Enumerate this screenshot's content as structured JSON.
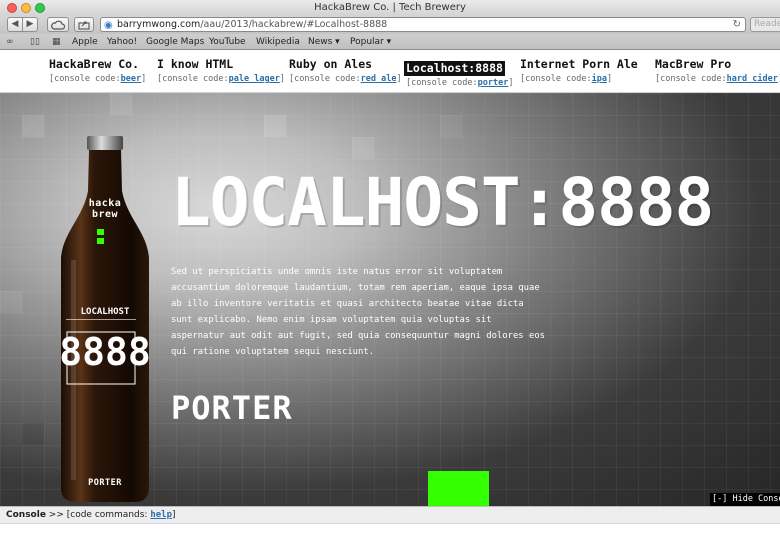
{
  "window": {
    "title": "HackaBrew Co. | Tech Brewery"
  },
  "toolbar": {
    "back_glyph": "◀",
    "forward_glyph": "▶",
    "url_domain": "barrymwong.com",
    "url_path": "/aau/2013/hackabrew/#Localhost-8888",
    "reader_label": "Reader",
    "reload_glyph": "↻"
  },
  "bookmarks": {
    "items": [
      "Apple",
      "Yahoo!",
      "Google Maps",
      "YouTube",
      "Wikipedia",
      "News ▾",
      "Popular ▾"
    ]
  },
  "nav": {
    "code_prefix": "[console code:",
    "code_suffix": "]",
    "items": [
      {
        "name": "HackaBrew Co.",
        "code": "beer"
      },
      {
        "name": "I know HTML",
        "code": "pale lager"
      },
      {
        "name": "Ruby on Ales",
        "code": "red ale"
      },
      {
        "name": "Localhost:8888",
        "code": "porter"
      },
      {
        "name": "Internet Porn Ale",
        "code": "ipa"
      },
      {
        "name": "MacBrew Pro",
        "code": "hard cider"
      }
    ],
    "active_index": 3
  },
  "hero": {
    "title": "LOCALHOST:8888",
    "body": "Sed ut perspiciatis unde omnis iste natus error sit voluptatem accusantium doloremque laudantium, totam rem aperiam, eaque ipsa quae ab illo inventore veritatis et quasi architecto beatae vitae dicta sunt explicabo. Nemo enim ipsam voluptatem quia voluptas sit aspernatur aut odit aut fugit, sed quia consequuntur magni dolores eos qui ratione voluptatem sequi nesciunt.",
    "style": "PORTER",
    "bottle": {
      "brand_line1": "hacka",
      "brand_line2": "brew",
      "label_line1": "LOCALHOST",
      "label_line2": "8888",
      "bottom": "PORTER"
    },
    "hide_console": "[-] Hide Console"
  },
  "console": {
    "title": "Console",
    "prompt": " >> [code commands: ",
    "help": "help",
    "close": "]"
  },
  "colors": {
    "accent_green": "#33ff00",
    "nav_link": "#2a6fa8"
  }
}
